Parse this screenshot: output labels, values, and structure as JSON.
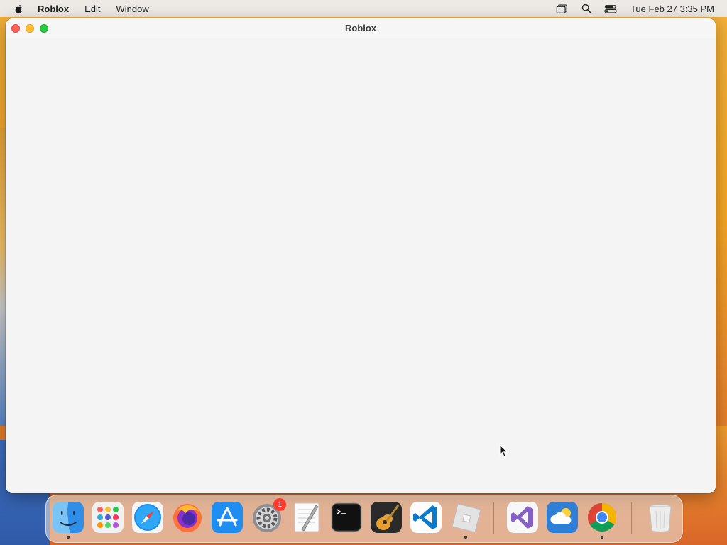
{
  "menubar": {
    "app_name": "Roblox",
    "items": [
      "Edit",
      "Window"
    ],
    "clock": "Tue Feb 27  3:35 PM"
  },
  "window": {
    "title": "Roblox"
  },
  "dock": {
    "apps": [
      {
        "name": "Finder",
        "running": true
      },
      {
        "name": "Launchpad",
        "running": false
      },
      {
        "name": "Safari",
        "running": false
      },
      {
        "name": "Firefox",
        "running": false
      },
      {
        "name": "App Store",
        "running": false
      },
      {
        "name": "System Settings",
        "running": false,
        "badge": "1"
      },
      {
        "name": "TextEdit",
        "running": false
      },
      {
        "name": "Terminal",
        "running": false
      },
      {
        "name": "GarageBand",
        "running": false
      },
      {
        "name": "Visual Studio Code",
        "running": false
      },
      {
        "name": "Roblox",
        "running": true
      },
      {
        "name": "Visual Studio",
        "running": false
      },
      {
        "name": "Weather",
        "running": false
      },
      {
        "name": "Google Chrome",
        "running": true
      },
      {
        "name": "Trash",
        "running": false
      }
    ]
  }
}
